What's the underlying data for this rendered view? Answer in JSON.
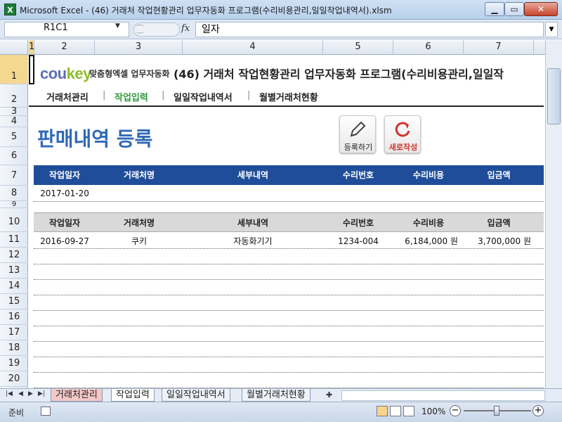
{
  "window": {
    "title": "Microsoft Excel - (46) 거래처 작업현황관리 업무자동화 프로그램(수리비용관리,일일작업내역서).xlsm",
    "app_icon": "X"
  },
  "formula_bar": {
    "name_box": "R1C1",
    "fx": "fx",
    "value": "일자"
  },
  "columns": [
    "1",
    "2",
    "3",
    "4",
    "5",
    "6",
    "7"
  ],
  "rows": [
    "1",
    "2",
    "3",
    "4",
    "5",
    "6",
    "7",
    "8",
    "9",
    "10",
    "11",
    "12",
    "13",
    "14",
    "15",
    "16",
    "17",
    "18",
    "19",
    "20"
  ],
  "logo": {
    "cou": "cou",
    "key": "key",
    "sub": "맞춤형엑셀 업무자동화"
  },
  "doc_title": "(46) 거래처 작업현황관리 업무자동화 프로그램(수리비용관리,일일작",
  "nav": {
    "items": [
      "거래처관리",
      "작업입력",
      "일일작업내역서",
      "월별거래처현황"
    ],
    "separator": "|",
    "active_color": "#2e9b3a"
  },
  "page_title": "판매내역 등록",
  "buttons": {
    "register": "등록하기",
    "new": "새로작성"
  },
  "input_table": {
    "headers": [
      "작업일자",
      "거래처명",
      "세부내역",
      "수리번호",
      "수리비용",
      "입금액"
    ],
    "row": [
      "2017-01-20",
      "",
      "",
      "",
      "",
      ""
    ]
  },
  "list_table": {
    "headers": [
      "작업일자",
      "거래처명",
      "세부내역",
      "수리번호",
      "수리비용",
      "입금액"
    ],
    "rows": [
      [
        "2016-09-27",
        "쿠키",
        "자동화기기",
        "1234-004",
        "6,184,000 원",
        "3,700,000 원"
      ]
    ]
  },
  "sheet_tabs": [
    "거래처관리",
    "작업입력",
    "일일작업내역서",
    "월별거래처현황"
  ],
  "status": {
    "ready": "준비",
    "zoom": "100%",
    "zoom_minus": "−",
    "zoom_plus": "+"
  },
  "colors": {
    "header_blue": "#1f4d99",
    "title_blue": "#2f69b6",
    "tab_active_pink": "#f4c7c7"
  }
}
